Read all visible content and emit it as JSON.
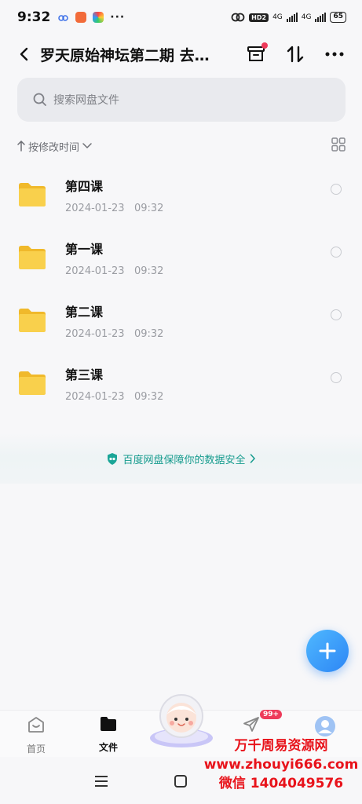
{
  "status_bar": {
    "time": "9:32",
    "hd": "HD2",
    "net1": "4G",
    "net2": "4G",
    "battery": "65"
  },
  "header": {
    "title": "罗天原始神坛第二期 去…"
  },
  "search": {
    "placeholder": "搜索网盘文件"
  },
  "sort": {
    "label": "按修改时间"
  },
  "files": [
    {
      "name": "第四课",
      "date": "2024-01-23   09:32"
    },
    {
      "name": "第一课",
      "date": "2024-01-23   09:32"
    },
    {
      "name": "第二课",
      "date": "2024-01-23   09:32"
    },
    {
      "name": "第三课",
      "date": "2024-01-23   09:32"
    }
  ],
  "safety": {
    "text": "百度网盘保障你的数据安全"
  },
  "bottom_nav": {
    "home": "首页",
    "files": "文件",
    "badge": "99+"
  },
  "watermark": {
    "line1": "万千周易资源网",
    "line2": "www.zhouyi666.com",
    "line3": "微信 1404049576"
  },
  "colors": {
    "accent": "#2d86f5",
    "folder": "#f7c948",
    "safety": "#169b8e",
    "badge": "#ee3a5a",
    "watermark": "#e8131b"
  }
}
